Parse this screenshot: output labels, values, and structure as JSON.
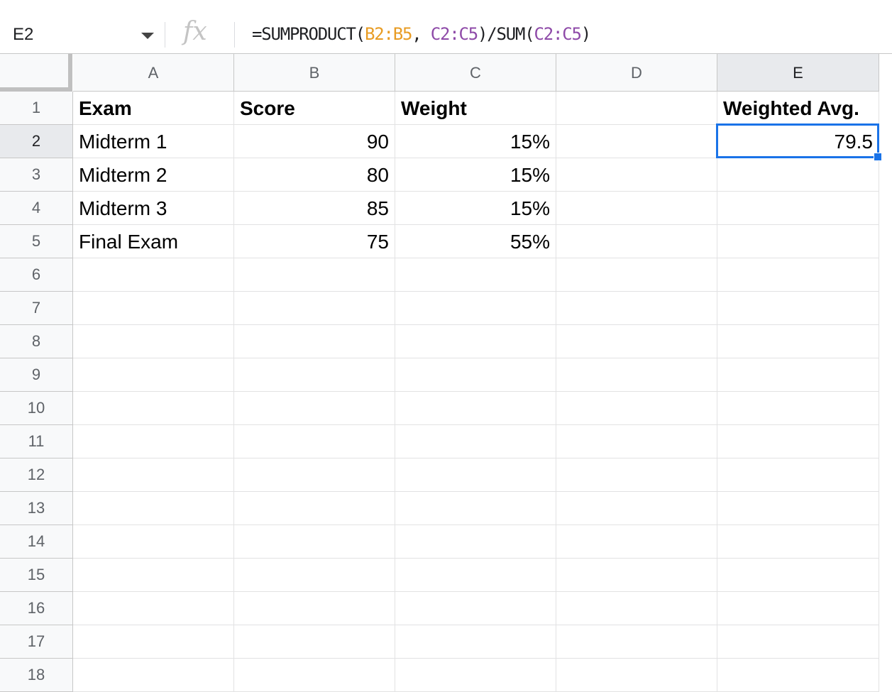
{
  "formula_bar": {
    "name_box": "E2",
    "fx_label": "fx",
    "formula_parts": [
      "=SUMPRODUCT(",
      "B2:B5",
      ", ",
      "C2:C5",
      ")/SUM(",
      "C2:C5",
      ")"
    ]
  },
  "columns": [
    "A",
    "B",
    "C",
    "D",
    "E"
  ],
  "rows": [
    "1",
    "2",
    "3",
    "4",
    "5",
    "6",
    "7",
    "8",
    "9",
    "10",
    "11",
    "12",
    "13",
    "14",
    "15",
    "16",
    "17",
    "18"
  ],
  "cells": {
    "A1": "Exam",
    "B1": "Score",
    "C1": "Weight",
    "E1": "Weighted Avg.",
    "A2": "Midterm 1",
    "B2": "90",
    "C2": "15%",
    "E2": "79.5",
    "A3": "Midterm 2",
    "B3": "80",
    "C3": "15%",
    "A4": "Midterm 3",
    "B4": "85",
    "C4": "15%",
    "A5": "Final Exam",
    "B5": "75",
    "C5": "55%"
  },
  "selection": {
    "cell": "E2",
    "column": "E",
    "row": "2"
  },
  "colors": {
    "selection": "#1a73e8",
    "range_orange": "#e89c24",
    "range_purple": "#8e4aa8"
  },
  "icons": {
    "name_box_dropdown": "caret-down-icon"
  }
}
